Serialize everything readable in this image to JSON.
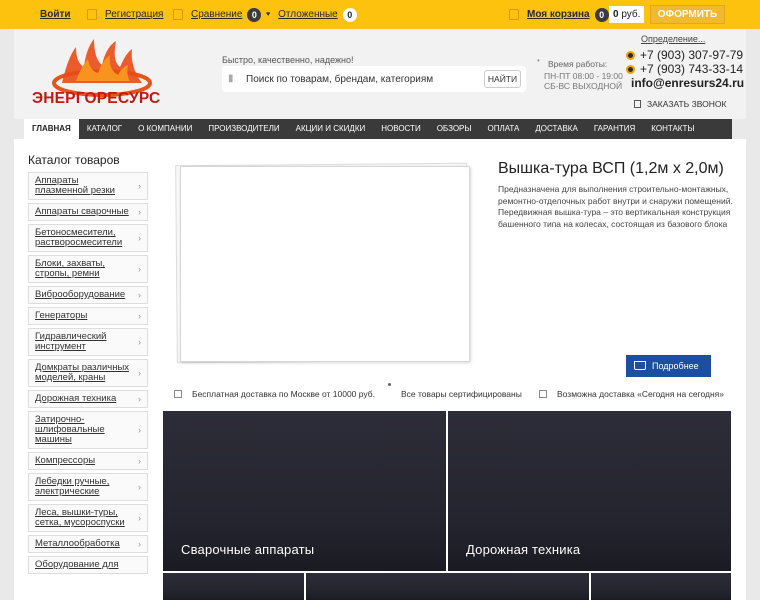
{
  "topbar": {
    "login": "Войти",
    "register": "Регистрация",
    "compare": "Сравнение",
    "compare_count": "0",
    "deferred": "Отложенные",
    "deferred_count": "0",
    "cart": "Моя корзина",
    "cart_count": "0",
    "price_amount": "0",
    "price_currency": "руб.",
    "checkout": "ОФОРМИТЬ"
  },
  "header": {
    "logo_text": "ЭНЕРГОРЕСУРС",
    "tagline": "Быстро, качественно, надежно!",
    "search_placeholder": "Поиск по товарам, брендам, категориям",
    "search_button": "НАЙТИ",
    "hours_title": "Время работы:",
    "hours_weekdays": "ПН-ПТ 08:00 - 19:00",
    "hours_weekend": "СБ-ВС ВЫХОДНОЙ",
    "city": "Определение...",
    "phone1": "+7 (903) 307-97-79",
    "phone2": "+7 (903) 743-33-14",
    "email": "info@enresurs24.ru",
    "callback": "ЗАКАЗАТЬ ЗВОНОК"
  },
  "nav": [
    "ГЛАВНАЯ",
    "КАТАЛОГ",
    "О КОМПАНИИ",
    "ПРОИЗВОДИТЕЛИ",
    "АКЦИИ И СКИДКИ",
    "НОВОСТИ",
    "ОБЗОРЫ",
    "ОПЛАТА",
    "ДОСТАВКА",
    "ГАРАНТИЯ",
    "КОНТАКТЫ"
  ],
  "catalog": {
    "title": "Каталог товаров",
    "items": [
      "Аппараты плазменной резки",
      "Аппараты сварочные",
      "Бетоносмесители, растворосмесители",
      "Блоки, захваты, стропы, ремни",
      "Виброоборудование",
      "Генераторы",
      "Гидравлический инструмент",
      "Домкраты различных моделей, краны",
      "Дорожная техника",
      "Затирочно-шлифовальные машины",
      "Компрессоры",
      "Лебедки ручные, электрические",
      "Леса, вышки-туры, сетка, мусороспуски",
      "Металлообработка",
      "Оборудование для"
    ]
  },
  "product": {
    "title": "Вышка-тура ВСП (1,2м х 2,0м)",
    "description": "Предназначена для выполнения строительно-монтажных, ремонтно-отделочных работ внутри и снаружи помещений. Передвижная вышка-тура – это вертикальная конструкция башенного типа на колесах, состоящая из базового блока и",
    "more_button": "Подробнее"
  },
  "features": [
    "Бесплатная доставка по Москве от 10000 руб.",
    "Все товары сертифицированы",
    "Возможна доставка «Сегодня на сегодня»"
  ],
  "tiles": [
    "Сварочные аппараты",
    "Дорожная техника"
  ],
  "colors": {
    "topbar": "#fcc20e",
    "nav": "#3a3a3a",
    "accent_blue": "#1a4fa3",
    "logo_red": "#c11a10",
    "tile_dark": "#26272f"
  }
}
